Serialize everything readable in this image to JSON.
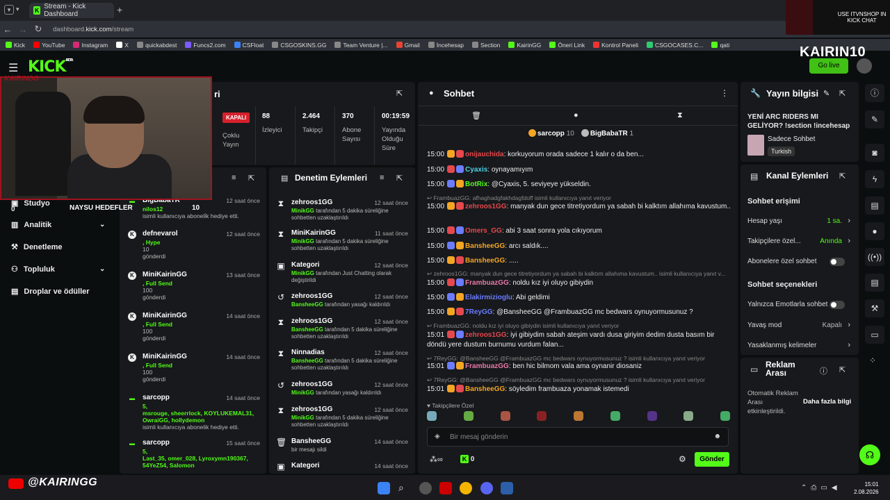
{
  "browser": {
    "tab_title": "Stream - Kick Dashboard",
    "url_prefix": "dashboard.",
    "url_domain": "kick.com",
    "url_path": "/stream",
    "bookmarks": [
      "Kick",
      "YouTube",
      "Instagram",
      "X",
      "quickabdest",
      "Funcs2.com",
      "CSFloat",
      "CSGOSKINS.GG",
      "Team Venture |...",
      "Gmail",
      "İncehesap",
      "Section",
      "KairinGG",
      "Öneri Link",
      "Kontrol Paneli",
      "CSGOCASES.C...",
      "qati"
    ],
    "bookmark_colors": [
      "#53fc18",
      "#ff0000",
      "#d62976",
      "#ffffff",
      "#888888",
      "#7a5cff",
      "#3b82f6",
      "#888888",
      "#888888",
      "#ea4335",
      "#888888",
      "#888888",
      "#53fc18",
      "#53fc18",
      "#e33",
      "#2ecc71",
      "#53fc18"
    ]
  },
  "overlay": {
    "promo_text": "USE ITVNSHOP IN KICK CHAT",
    "stream_title": "KAIRIN10",
    "cam_tag": "KAIRINGG",
    "goal_label": "NAYSU HEDEFLER",
    "goal_value": "10",
    "youtube_handle": "@KAIRINGG"
  },
  "header": {
    "logo": "KICK",
    "logo_sup": "BETA",
    "go_live": "Go live"
  },
  "sidebar": {
    "items": [
      {
        "label": "Studyo",
        "icon": "studio-icon"
      },
      {
        "label": "Analitik",
        "icon": "chart-icon",
        "chevron": true
      },
      {
        "label": "Denetleme",
        "icon": "hammer-icon"
      },
      {
        "label": "Topluluk",
        "icon": "people-icon",
        "chevron": true
      },
      {
        "label": "Droplar ve ödüller",
        "icon": "gift-icon"
      }
    ],
    "count_visible": "0"
  },
  "stream_info": {
    "title_fragment": "ri",
    "status": "KAPALI",
    "status_label": "Çoklu Yayın",
    "stats": [
      {
        "value": "88",
        "label": "İzleyici"
      },
      {
        "value": "2.464",
        "label": "Takipçi"
      },
      {
        "value": "370",
        "label": "Abone Sayısı"
      },
      {
        "value": "00:19:59",
        "label": "Yayında Olduğu Süre"
      }
    ]
  },
  "activity": {
    "items": [
      {
        "icon": "gift",
        "name": "BigBabaTR",
        "time": "12 saat önce",
        "lines": [
          [
            "nilos12",
            "green"
          ],
          [
            "isimli kullanıcıya aboneli̇k hediye etti.",
            "grey"
          ]
        ]
      },
      {
        "icon": "kick",
        "name": "defnevarol",
        "time": "12 saat önce",
        "lines": [
          [
            ", Hype",
            "green"
          ],
          [
            "10",
            "grey"
          ],
          [
            "gönderdi",
            "grey"
          ]
        ]
      },
      {
        "icon": "kick",
        "name": "MiniKairinGG",
        "time": "13 saat önce",
        "lines": [
          [
            ", Full Send",
            "green"
          ],
          [
            "100",
            "grey"
          ],
          [
            "gönderdi",
            "grey"
          ]
        ]
      },
      {
        "icon": "kick",
        "name": "MiniKairinGG",
        "time": "14 saat önce",
        "lines": [
          [
            ", Full Send",
            "green"
          ],
          [
            "100",
            "grey"
          ],
          [
            "gönderdi",
            "grey"
          ]
        ]
      },
      {
        "icon": "kick",
        "name": "MiniKairinGG",
        "time": "14 saat önce",
        "lines": [
          [
            ", Full Send",
            "green"
          ],
          [
            "100",
            "grey"
          ],
          [
            "gönderdi",
            "grey"
          ]
        ]
      },
      {
        "icon": "gift",
        "name": "sarcopp",
        "time": "14 saat önce",
        "lines": [
          [
            "5,",
            "green"
          ],
          [
            "msrouge, sheerrlock, KOYLUKEMAL31,",
            "green"
          ],
          [
            "OwraiGG, hollydemon",
            "green"
          ],
          [
            "isimli kullanıcıya abonelik hediye etti.",
            "grey"
          ]
        ]
      },
      {
        "icon": "gift",
        "name": "sarcopp",
        "time": "15 saat önce",
        "lines": [
          [
            "5,",
            "green"
          ],
          [
            "Last_35, omer_028, Lyroxymn190367,",
            "green"
          ],
          [
            "54YeZ54, Salomon",
            "green"
          ]
        ]
      }
    ]
  },
  "moderation": {
    "title": "Denetim Eylemleri",
    "items": [
      {
        "icon": "timeout",
        "name": "zehroos1GG",
        "time": "12 saat önce",
        "actor": "MinikGG",
        "text": "tarafından 5 dakika süreliğine sohbetten uzaklaştırıldı"
      },
      {
        "icon": "timeout",
        "name": "MiniKairinGG",
        "time": "11 saat önce",
        "actor": "MinikGG",
        "text": "tarafından 5 dakika süreliğine sohbetten uzaklaştırıldı"
      },
      {
        "icon": "category",
        "name": "Kategori",
        "time": "12 saat önce",
        "actor": "MinikGG",
        "text": "tarafından Just Chatting olarak değiştirildi"
      },
      {
        "icon": "unban",
        "name": "zehroos1GG",
        "time": "12 saat önce",
        "actor": "BansheeGG",
        "text": "tarafından yasağı kaldırıldı"
      },
      {
        "icon": "timeout",
        "name": "zehroos1GG",
        "time": "12 saat önce",
        "actor": "BansheeGG",
        "text": "tarafından 5 dakika süreliğine sohbetten uzaklaştırıldı"
      },
      {
        "icon": "timeout",
        "name": "Ninnadias",
        "time": "12 saat önce",
        "actor": "BansheeGG",
        "text": "tarafından 5 dakika süreliğine sohbetten uzaklaştırıldı"
      },
      {
        "icon": "unban",
        "name": "zehroos1GG",
        "time": "12 saat önce",
        "actor": "MinikGG",
        "text": "tarafından yasağı kaldırıldı"
      },
      {
        "icon": "timeout",
        "name": "zehroos1GG",
        "time": "12 saat önce",
        "actor": "MinikGG",
        "text": "tarafından 5 dakika süreliğine sohbetten uzaklaştırıldı"
      },
      {
        "icon": "delete",
        "name": "BansheeGG",
        "time": "14 saat önce",
        "actor": "",
        "text": "bir mesajı sildi"
      },
      {
        "icon": "category",
        "name": "Kategori",
        "time": "14 saat önce",
        "actor": "",
        "text": ""
      }
    ]
  },
  "chat": {
    "title": "Sohbet",
    "top_users": [
      {
        "name": "sarcopp",
        "count": "10"
      },
      {
        "name": "BigBabaTR",
        "count": "1"
      }
    ],
    "messages": [
      {
        "ts": "15:00",
        "user": "onijauchida",
        "color": "#e5484d",
        "text": "korkuyorum orada sadece 1 kalır o da ben...",
        "reply": ""
      },
      {
        "ts": "15:00",
        "user": "Cyaxis",
        "color": "#4fd1e5",
        "text": "oynayamıyım",
        "reply": ""
      },
      {
        "ts": "15:00",
        "user": "BotRix",
        "color": "#53fc18",
        "text": "@Cyaxis, 5. seviyeye yükseldin.",
        "reply": ""
      },
      {
        "ts": "15:00",
        "user": "zehroos1GG",
        "color": "#e5484d",
        "text": "manyak dun gece titretiyordum ya sabah bi kalktım allahıma kavustum..",
        "reply": "FrambuazGG: afhaghadgfakhdagfdoff isimli kullanıcıya yanıt veriyor"
      },
      {
        "ts": "15:00",
        "user": "Omers_GG",
        "color": "#e5484d",
        "text": "abi 3 saat sonra yola cıkıyorum",
        "reply": ""
      },
      {
        "ts": "15:00",
        "user": "BansheeGG",
        "color": "#f5a524",
        "text": "arcı saldık....",
        "reply": ""
      },
      {
        "ts": "15:00",
        "user": "BansheeGG",
        "color": "#f5a524",
        "text": ".....",
        "reply": ""
      },
      {
        "ts": "15:00",
        "user": "FrambuazGG",
        "color": "#e879a9",
        "text": "noldu kız iyi oluyo gibiydin",
        "reply": "zehroos1GG: manyak dun gece titretiyordum ya sabah bi kalktım allahıma kavustum.. isimli kullanıcıya yanıt v..."
      },
      {
        "ts": "15:00",
        "user": "Elakirmizioglu",
        "color": "#6b7cff",
        "text": "Abi geldimi",
        "reply": ""
      },
      {
        "ts": "15:00",
        "user": "7ReyGG",
        "color": "#6b7cff",
        "text": "@BansheeGG @FrambuazGG mc bedwars oynuyormusunuz ?",
        "reply": ""
      },
      {
        "ts": "15:01",
        "user": "zehroos1GG",
        "color": "#e5484d",
        "text": "iyi gibiydim sabah ateşim vardı dusa giriyim dedim dusta basım bir döndü yere dustum burnumu vurdum falan...",
        "reply": "FrambuazGG: noldu kız iyi oluyo gibiydin isimli kullanıcıya yanıt veriyor"
      },
      {
        "ts": "15:01",
        "user": "FrambuazGG",
        "color": "#e879a9",
        "text": "ben hic bilmom vala ama oynanir diosaniz",
        "reply": "7ReyGG: @BansheeGG @FrambuazGG mc bedwars oynuyormusunuz ? isimli kullanıcıya yanıt veriyor"
      },
      {
        "ts": "15:01",
        "user": "BansheeGG",
        "color": "#f5a524",
        "text": "söyledim frambuaza yonamak istemedi",
        "reply": "7ReyGG: @BansheeGG @FrambuazGG mc bedwars oynuyormusunuz ? isimli kullanıcıya yanıt veriyor"
      }
    ],
    "followers_only": "Takipçilere Özel",
    "input_placeholder": "Bir mesaj gönderin",
    "points": "0",
    "send": "Gönder"
  },
  "stream_panel": {
    "title": "Yayın bilgisi",
    "stream_name": "YENİ ARC RIDERS MI GELİYOR? !section !incehesap",
    "category": "Sadece Sohbet",
    "language": "Turkish"
  },
  "channel_actions": {
    "title": "Kanal Eylemleri",
    "section1": "Sohbet erişimi",
    "rows1": [
      {
        "label": "Hesap yaşı",
        "value": "1 sa.",
        "type": "link"
      },
      {
        "label": "Takipçilere özel...",
        "value": "Anında",
        "type": "link"
      },
      {
        "label": "Abonelere özel sohbet",
        "value": "",
        "type": "toggle"
      }
    ],
    "section2": "Sohbet seçenekleri",
    "rows2": [
      {
        "label": "Yalnızca Emotlarla sohbet",
        "value": "",
        "type": "toggle"
      },
      {
        "label": "Yavaş mod",
        "value": "Kapalı",
        "type": "link"
      },
      {
        "label": "Yasaklanmış kelimeler",
        "value": "",
        "type": "link"
      }
    ]
  },
  "ad_break": {
    "title": "Reklam Arası",
    "text": "Otomatik Reklam Arası etkinleştirildi.",
    "link": "Daha fazla bilgi"
  },
  "system": {
    "time": "15:01",
    "date": "2.08.2026"
  }
}
